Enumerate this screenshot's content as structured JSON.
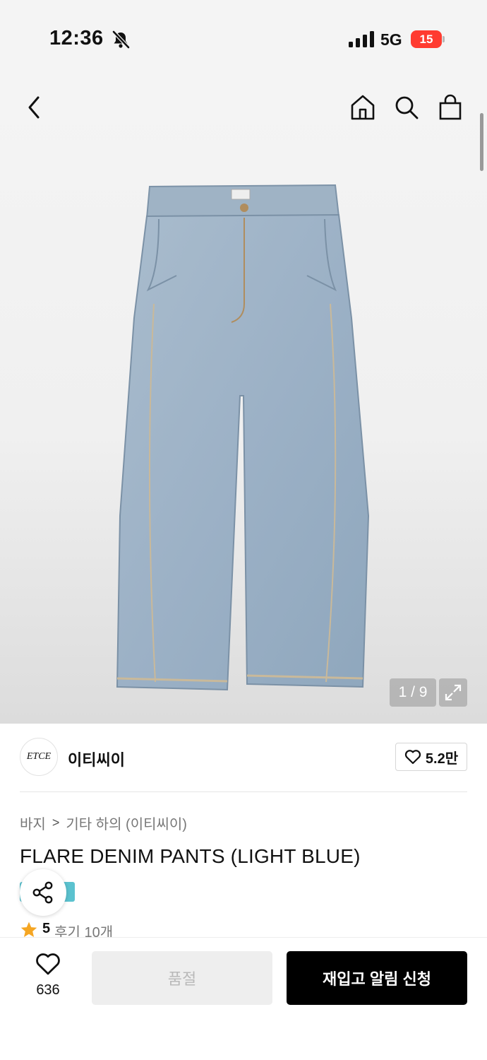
{
  "status_bar": {
    "time": "12:36",
    "network": "5G",
    "battery": "15"
  },
  "hero": {
    "page_counter": "1 / 9"
  },
  "brand": {
    "logo_text": "ETCE",
    "name": "이티씨이",
    "likes": "5.2만"
  },
  "breadcrumb": {
    "category": "바지",
    "subcategory": "기타 하의 (이티씨이)"
  },
  "product": {
    "title": "FLARE DENIM PANTS (LIGHT BLUE)"
  },
  "rating": {
    "score": "5",
    "reviews": "후기 10개"
  },
  "bottom_bar": {
    "wish_count": "636",
    "soldout_label": "품절",
    "restock_label": "재입고 알림 신청"
  },
  "colors": {
    "accent": "#000000",
    "badge": "#5bc2cf",
    "star": "#f5a623",
    "battery": "#ff3b30"
  },
  "icons": [
    "bell-off-icon",
    "signal-icon",
    "back-icon",
    "home-icon",
    "search-icon",
    "shopping-bag-icon",
    "expand-icon",
    "heart-icon",
    "share-icon",
    "star-icon"
  ]
}
